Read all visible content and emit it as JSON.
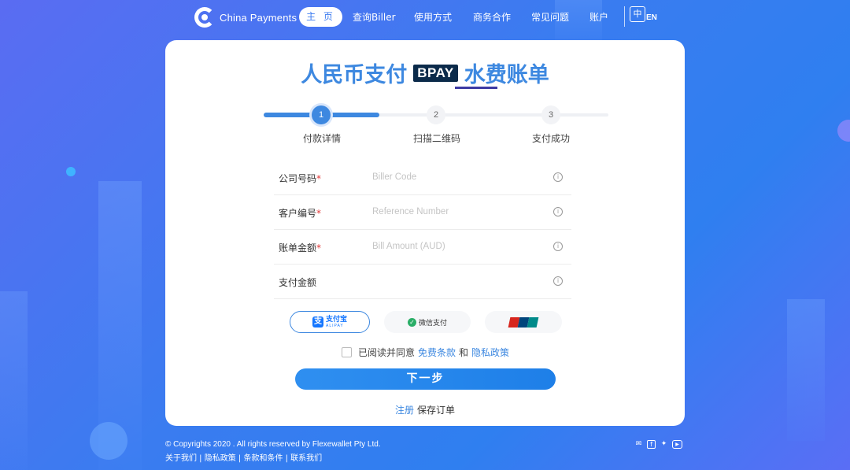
{
  "nav": {
    "logo_text": "China Payments",
    "items": [
      "主 页",
      "查询Biller",
      "使用方式",
      "商务合作",
      "常见问题",
      "账户"
    ],
    "lang_zh": "中",
    "lang_en": "EN"
  },
  "card": {
    "title_left": "人民币支付",
    "title_brand": "BPAY",
    "title_right": "水费账单",
    "steps": [
      {
        "number": "1",
        "label": "付款详情"
      },
      {
        "number": "2",
        "label": "扫描二维码"
      },
      {
        "number": "3",
        "label": "支付成功"
      }
    ],
    "fields": [
      {
        "label": "公司号码",
        "required_mark": "*",
        "placeholder": "Biller Code"
      },
      {
        "label": "客户编号",
        "required_mark": "*",
        "placeholder": "Reference Number"
      },
      {
        "label": "账单金额",
        "required_mark": "*",
        "placeholder": "Bill Amount (AUD)"
      },
      {
        "label": "支付金额",
        "required_mark": "",
        "placeholder": ""
      }
    ],
    "info_glyph": "i",
    "payment": {
      "alipay_name": "支付宝",
      "alipay_sub": "ALIPAY",
      "alipay_glyph": "支",
      "wechat_name": "微信支付",
      "wechat_glyph": "✓",
      "unionpay_name": "UnionPay"
    },
    "agreement": {
      "prefix": "已阅读并同意",
      "terms": "免费条款",
      "and": "和",
      "privacy": "隐私政策"
    },
    "next_button": "下一步",
    "register": "注册",
    "save_order": "保存订单"
  },
  "footer": {
    "copyright": "© Copyrights 2020 . All rights reserved by Flexewallet Pty Ltd.",
    "links": "关于我们 | 隐私政策 | 条款和条件 | 联系我们",
    "social": [
      {
        "icon": "wechat-icon",
        "glyph": "✉"
      },
      {
        "icon": "facebook-icon",
        "glyph": "f"
      },
      {
        "icon": "twitter-icon",
        "glyph": "✦"
      },
      {
        "icon": "youtube-icon",
        "glyph": "▶"
      }
    ]
  },
  "colors": {
    "accent": "#3d88e0",
    "required": "#e23b3b",
    "bpay_bg": "#0b2a4a"
  }
}
